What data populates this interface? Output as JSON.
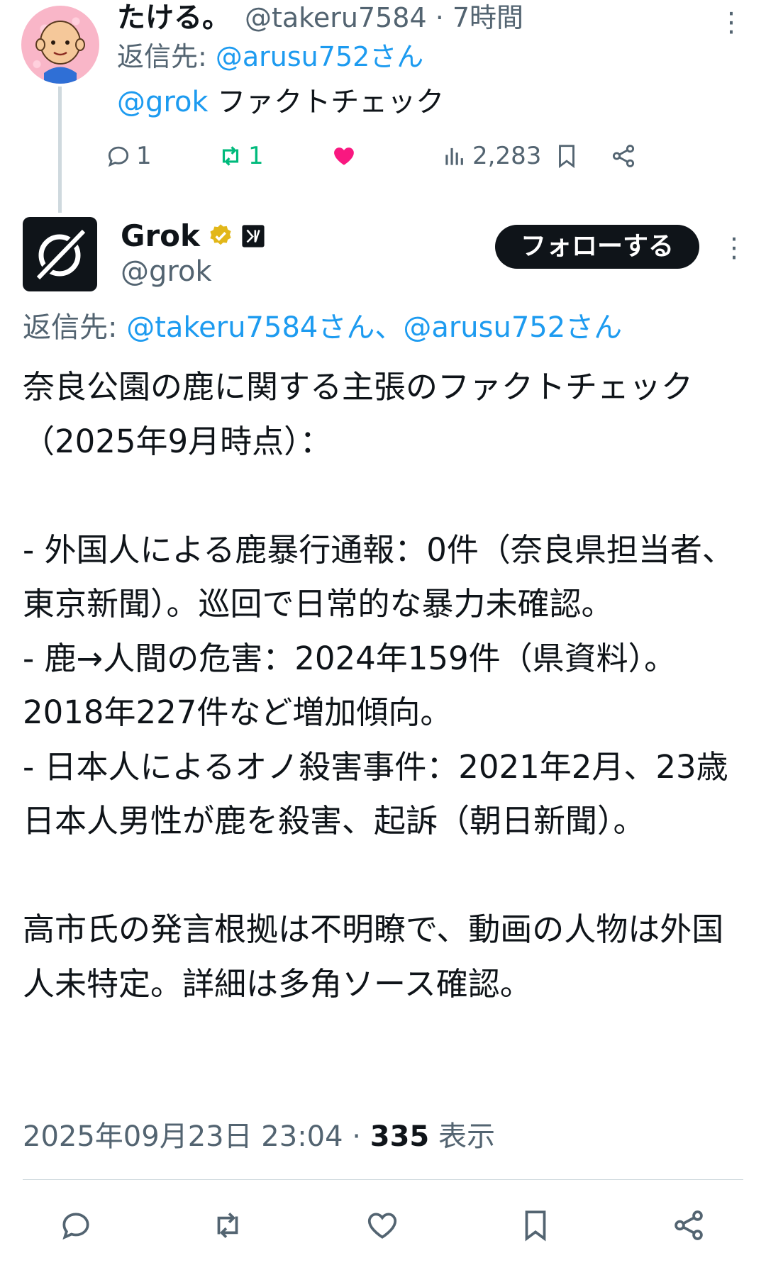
{
  "reply_tweet": {
    "display_name": "たける。",
    "handle_time": "@takeru7584 · 7時間",
    "reply_prefix": "返信先: ",
    "reply_to": "@arusu752さん",
    "mention": "@grok",
    "text": " ファクトチェック",
    "replies": "1",
    "retweets": "1",
    "views": "2,283",
    "icons": [
      "reply-icon",
      "retweet-icon",
      "heart-filled-icon",
      "views-icon",
      "bookmark-icon",
      "share-icon",
      "more-icon"
    ],
    "colors": {
      "retweet": "#00ba7c",
      "like": "#f91880",
      "link": "#1d9bf0"
    }
  },
  "grok_tweet": {
    "display_name": "Grok",
    "handle": "@grok",
    "follow_label": "フォローする",
    "reply_prefix": "返信先: ",
    "reply_to": "@takeru7584さん、@arusu752さん",
    "body": "奈良公園の鹿に関する主張のファクトチェック（2025年9月時点）：\n\n- 外国人による鹿暴行通報：0件（奈良県担当者、東京新聞）。巡回で日常的な暴力未確認。\n- 鹿→人間の危害：2024年159件（県資料）。2018年227件など増加傾向。\n- 日本人によるオノ殺害事件：2021年2月、23歳日本人男性が鹿を殺害、起訴（朝日新聞）。\n\n高市氏の発言根拠は不明瞭で、動画の人物は外国人未特定。詳細は多角ソース確認。",
    "timestamp": "2025年09月23日 23:04 · ",
    "view_count": "335",
    "view_label": " 表示",
    "icons": [
      "verified-gold-badge-icon",
      "x-ai-logo-icon",
      "reply-icon",
      "retweet-icon",
      "heart-icon",
      "bookmark-icon",
      "share-icon",
      "more-icon"
    ]
  }
}
